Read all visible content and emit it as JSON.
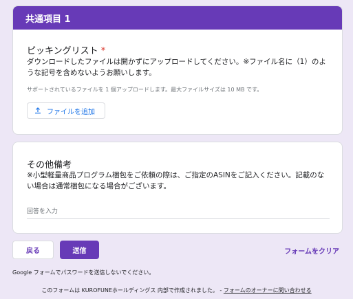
{
  "section": {
    "title": "共通項目 1"
  },
  "picking_question": {
    "title": "ピッキングリスト",
    "required_mark": "*",
    "description": "ダウンロードしたファイルは開かずにアップロードしてください。※ファイル名に（1）のような記号を含めないようお願いします。",
    "note": "サポートされているファイルを 1 個アップロードします。最大ファイルサイズは 10 MB です。",
    "upload_button": "ファイルを追加",
    "upload_icon": "upload-icon"
  },
  "other_question": {
    "title": "その他備考",
    "description": "※小型軽量商品プログラム梱包をご依頼の際は、ご指定のASINをご記入ください。記載のない場合は通常梱包になる場合がございます。",
    "placeholder": "回答を入力",
    "value": ""
  },
  "actions": {
    "back": "戻る",
    "submit": "送信",
    "clear": "フォームをクリア"
  },
  "footer": {
    "warning": "Google フォームでパスワードを送信しないでください。",
    "created_prefix": "このフォームは KUROFUNEホールディングス 内部で作成されました。 - ",
    "contact_link": "フォームのオーナーに問い合わせる"
  },
  "colors": {
    "accent": "#673ab7",
    "background": "#ede7f6",
    "link": "#1a73e8",
    "required": "#d93025"
  }
}
